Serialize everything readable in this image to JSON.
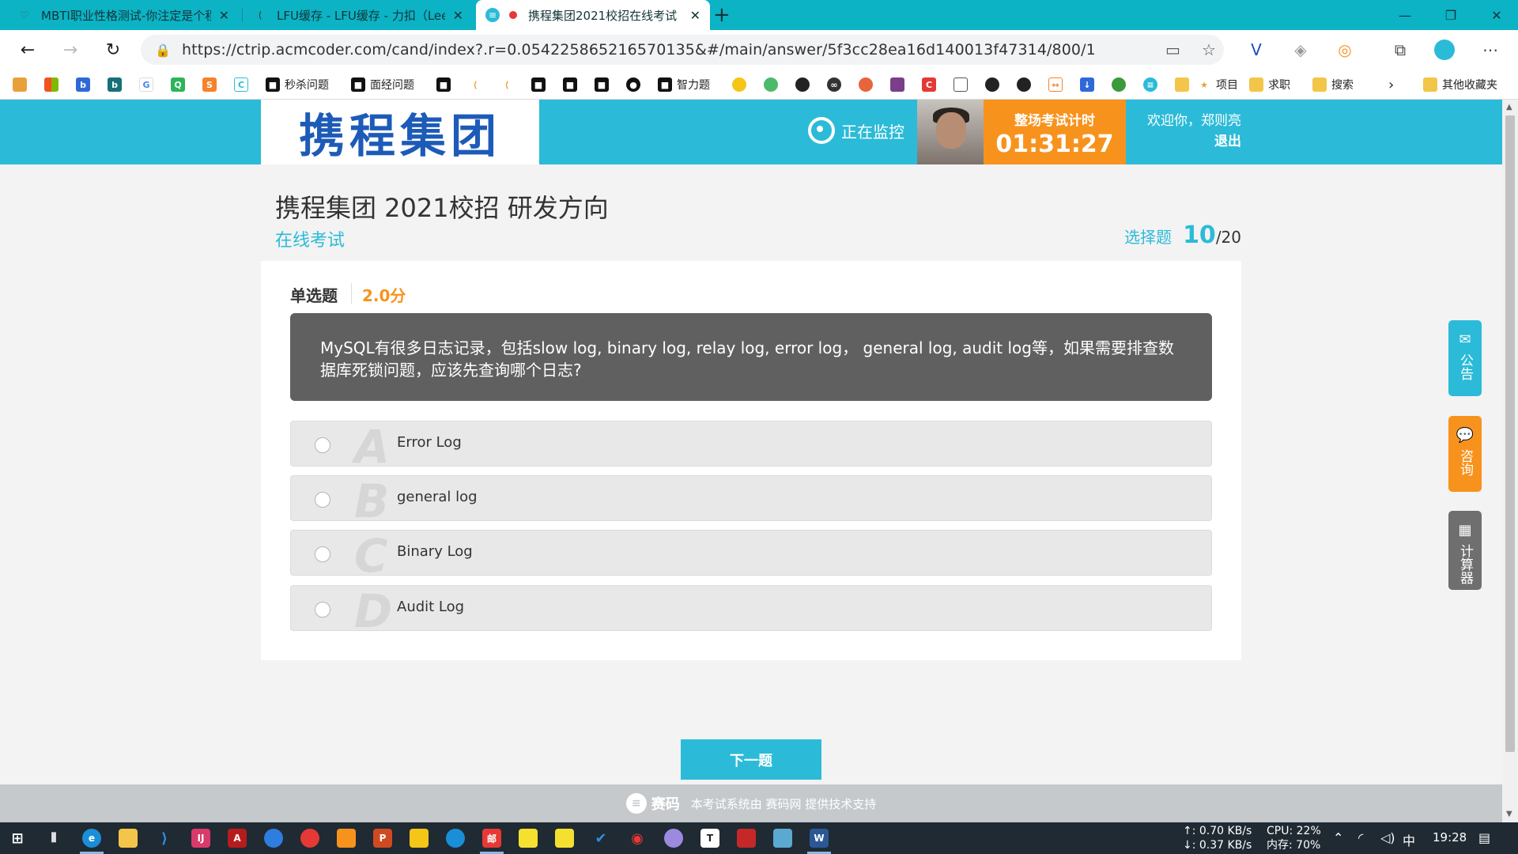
{
  "browser": {
    "tabs": [
      {
        "title": "MBTI职业性格测试-你注定是个程",
        "icon": "heart-icon"
      },
      {
        "title": "LFU缓存 - LFU缓存 - 力扣（LeetCode）",
        "icon": "leetcode-icon"
      },
      {
        "title": "携程集团2021校招在线考试",
        "icon": "saima-icon"
      }
    ],
    "close_glyph": "✕",
    "url": "https://ctrip.acmcoder.com/cand/index?.r=0.054225865216570135&#/main/answer/5f3cc28ea16d140013f47314/800/1",
    "bookmarks": [
      "秒杀问题",
      "面经问题",
      "智力题",
      "项目",
      "求职",
      "搜索",
      "其他收藏夹"
    ]
  },
  "header": {
    "logo_text": "携程集团",
    "monitor_label": "正在监控",
    "timer_label": "整场考试计时",
    "timer_value": "01:31:27",
    "welcome": "欢迎你，郑则亮",
    "logout": "退出"
  },
  "exam": {
    "title": "携程集团 2021校招 研发方向",
    "subtitle": "在线考试",
    "section_label": "选择题",
    "current": "10",
    "total": "/20"
  },
  "question": {
    "type": "单选题",
    "score": "2.0分",
    "text": "MySQL有很多日志记录，包括slow log, binary log, relay log, error log， general log, audit log等，如果需要排查数据库死锁问题，应该先查询哪个日志?",
    "options": [
      {
        "letter": "A",
        "text": "Error Log"
      },
      {
        "letter": "B",
        "text": "general log"
      },
      {
        "letter": "C",
        "text": "Binary Log"
      },
      {
        "letter": "D",
        "text": "Audit Log"
      }
    ]
  },
  "next_button": "下一题",
  "footer": {
    "logo": "赛码",
    "text": "本考试系统由 赛码网 提供技术支持"
  },
  "side": {
    "notice": "公告",
    "consult": "咨询",
    "calculator": "计算器"
  },
  "taskbar": {
    "net_up": "↑: 0.70 KB/s",
    "net_down": "↓: 0.37 KB/s",
    "cpu": "CPU: 22%",
    "mem": "内存: 70%",
    "ime": "中",
    "time": "19:28"
  },
  "colors": {
    "accent": "#2bbbd8",
    "orange": "#f7931d",
    "tabbar": "#0bb3c4",
    "question_bg": "#606060"
  }
}
